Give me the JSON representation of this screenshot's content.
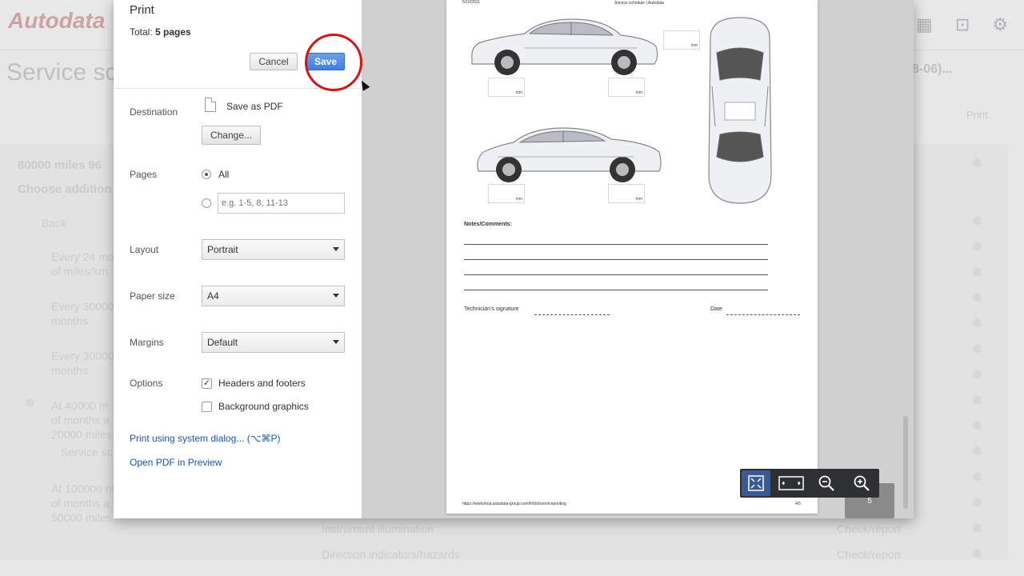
{
  "background": {
    "logo": "Autodata",
    "page_title": "Service sc",
    "code_fragment": "8-06)...",
    "print_label": "Print",
    "heading_interval": "80000 miles 96",
    "heading_choose": "Choose addition",
    "back_label": "Back",
    "rows": [
      {
        "text": "Every 24 mo\nof miles/km"
      },
      {
        "text": "Every 30000\nmonths"
      },
      {
        "text": "Every 30000\nmonths"
      },
      {
        "text": "At 40000 m\nof months a\n20000 miles"
      },
      {
        "text": "Service sc"
      },
      {
        "text": "At 100000 m\nof months a\n50000 miles"
      }
    ],
    "bottom_items": [
      {
        "label": "Instrument illumination",
        "action": "Check/report"
      },
      {
        "label": "Direction indicators/hazards",
        "action": "Check/report"
      }
    ]
  },
  "dialog": {
    "title": "Print",
    "total_label": "Total: ",
    "total_value": "5 pages",
    "cancel_label": "Cancel",
    "save_label": "Save",
    "destination_label": "Destination",
    "destination_value": "Save as PDF",
    "change_label": "Change...",
    "pages_label": "Pages",
    "pages_all": "All",
    "pages_placeholder": "e.g. 1-5, 8, 11-13",
    "layout_label": "Layout",
    "layout_value": "Portrait",
    "paper_label": "Paper size",
    "paper_value": "A4",
    "margins_label": "Margins",
    "margins_value": "Default",
    "options_label": "Options",
    "opt_headers": "Headers and footers",
    "opt_headers_checked": true,
    "opt_bg": "Background graphics",
    "opt_bg_checked": false,
    "system_dialog_link": "Print using system dialog... (⌥⌘P)",
    "open_preview_link": "Open PDF in Preview"
  },
  "preview": {
    "header_left": "5/10/2011",
    "header_center": "Service schedule | Autodata",
    "mm_label": "mm",
    "notes_label": "Notes/Comments:",
    "signature_label": "Technician's signature",
    "date_label": "Date",
    "footer_url": "https://workshop.autodata-group.com/fr/it/nl/serviceprinting",
    "footer_page": "4/5",
    "page_number": "5"
  }
}
